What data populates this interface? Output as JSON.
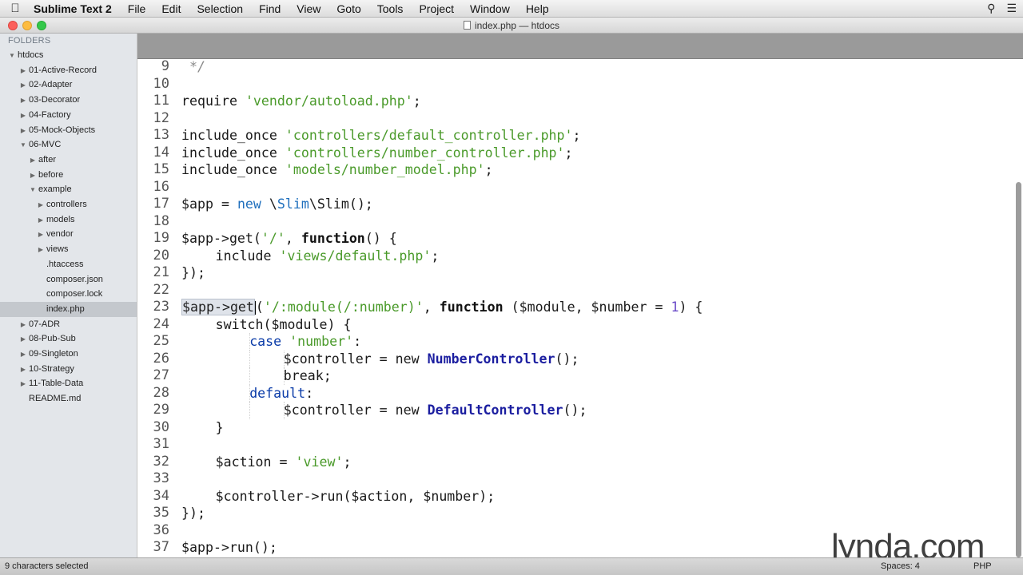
{
  "menubar": {
    "app_name": "Sublime Text 2",
    "items": [
      "File",
      "Edit",
      "Selection",
      "Find",
      "View",
      "Goto",
      "Tools",
      "Project",
      "Window",
      "Help"
    ],
    "right_icons": [
      "search-icon",
      "list-icon"
    ]
  },
  "window": {
    "title": "index.php — htdocs"
  },
  "sidebar": {
    "header": "FOLDERS",
    "items": [
      {
        "label": "htdocs",
        "depth": 0,
        "arrow": "▼"
      },
      {
        "label": "01-Active-Record",
        "depth": 1,
        "arrow": "▶"
      },
      {
        "label": "02-Adapter",
        "depth": 1,
        "arrow": "▶"
      },
      {
        "label": "03-Decorator",
        "depth": 1,
        "arrow": "▶"
      },
      {
        "label": "04-Factory",
        "depth": 1,
        "arrow": "▶"
      },
      {
        "label": "05-Mock-Objects",
        "depth": 1,
        "arrow": "▶"
      },
      {
        "label": "06-MVC",
        "depth": 1,
        "arrow": "▼"
      },
      {
        "label": "after",
        "depth": 2,
        "arrow": "▶"
      },
      {
        "label": "before",
        "depth": 2,
        "arrow": "▶"
      },
      {
        "label": "example",
        "depth": 2,
        "arrow": "▼"
      },
      {
        "label": "controllers",
        "depth": 3,
        "arrow": "▶"
      },
      {
        "label": "models",
        "depth": 3,
        "arrow": "▶"
      },
      {
        "label": "vendor",
        "depth": 3,
        "arrow": "▶"
      },
      {
        "label": "views",
        "depth": 3,
        "arrow": "▶"
      },
      {
        "label": ".htaccess",
        "depth": 3,
        "arrow": ""
      },
      {
        "label": "composer.json",
        "depth": 3,
        "arrow": ""
      },
      {
        "label": "composer.lock",
        "depth": 3,
        "arrow": ""
      },
      {
        "label": "index.php",
        "depth": 3,
        "arrow": "",
        "selected": true
      },
      {
        "label": "07-ADR",
        "depth": 1,
        "arrow": "▶"
      },
      {
        "label": "08-Pub-Sub",
        "depth": 1,
        "arrow": "▶"
      },
      {
        "label": "09-Singleton",
        "depth": 1,
        "arrow": "▶"
      },
      {
        "label": "10-Strategy",
        "depth": 1,
        "arrow": "▶"
      },
      {
        "label": "11-Table-Data",
        "depth": 1,
        "arrow": "▶"
      },
      {
        "label": "README.md",
        "depth": 1,
        "arrow": ""
      }
    ]
  },
  "editor": {
    "lines": [
      {
        "n": "9",
        "indent": 0,
        "tokens": [
          {
            "t": " */",
            "c": "cm"
          }
        ]
      },
      {
        "n": "10",
        "indent": 0,
        "tokens": []
      },
      {
        "n": "11",
        "indent": 0,
        "tokens": [
          {
            "t": "require ",
            "c": "op"
          },
          {
            "t": "'vendor/autoload.php'",
            "c": "str"
          },
          {
            "t": ";",
            "c": "op"
          }
        ]
      },
      {
        "n": "12",
        "indent": 0,
        "tokens": []
      },
      {
        "n": "13",
        "indent": 0,
        "tokens": [
          {
            "t": "include_once ",
            "c": "op"
          },
          {
            "t": "'controllers/default_controller.php'",
            "c": "str"
          },
          {
            "t": ";",
            "c": "op"
          }
        ]
      },
      {
        "n": "14",
        "indent": 0,
        "tokens": [
          {
            "t": "include_once ",
            "c": "op"
          },
          {
            "t": "'controllers/number_controller.php'",
            "c": "str"
          },
          {
            "t": ";",
            "c": "op"
          }
        ]
      },
      {
        "n": "15",
        "indent": 0,
        "tokens": [
          {
            "t": "include_once ",
            "c": "op"
          },
          {
            "t": "'models/number_model.php'",
            "c": "str"
          },
          {
            "t": ";",
            "c": "op"
          }
        ]
      },
      {
        "n": "16",
        "indent": 0,
        "tokens": []
      },
      {
        "n": "17",
        "indent": 0,
        "tokens": [
          {
            "t": "$app = ",
            "c": "op"
          },
          {
            "t": "new",
            "c": "new"
          },
          {
            "t": " \\",
            "c": "op"
          },
          {
            "t": "Slim",
            "c": "new"
          },
          {
            "t": "\\Slim();",
            "c": "op"
          }
        ]
      },
      {
        "n": "18",
        "indent": 0,
        "tokens": []
      },
      {
        "n": "19",
        "indent": 0,
        "tokens": [
          {
            "t": "$app->get(",
            "c": "op"
          },
          {
            "t": "'/'",
            "c": "str"
          },
          {
            "t": ", ",
            "c": "op"
          },
          {
            "t": "function",
            "c": "fn"
          },
          {
            "t": "() {",
            "c": "op"
          }
        ]
      },
      {
        "n": "20",
        "indent": 1,
        "tokens": [
          {
            "t": "include ",
            "c": "op"
          },
          {
            "t": "'views/default.php'",
            "c": "str"
          },
          {
            "t": ";",
            "c": "op"
          }
        ]
      },
      {
        "n": "21",
        "indent": 0,
        "tokens": [
          {
            "t": "});",
            "c": "op"
          }
        ]
      },
      {
        "n": "22",
        "indent": 0,
        "tokens": []
      },
      {
        "n": "23",
        "indent": 0,
        "tokens": [
          {
            "t": "$app->get",
            "c": "sel"
          },
          {
            "t": "(",
            "c": "op"
          },
          {
            "t": "'/:module(/:number)'",
            "c": "str"
          },
          {
            "t": ", ",
            "c": "op"
          },
          {
            "t": "function",
            "c": "fn"
          },
          {
            "t": " ($module, $number = ",
            "c": "op"
          },
          {
            "t": "1",
            "c": "num"
          },
          {
            "t": ") {",
            "c": "op"
          }
        ]
      },
      {
        "n": "24",
        "indent": 1,
        "tokens": [
          {
            "t": "switch($module) {",
            "c": "op"
          }
        ]
      },
      {
        "n": "25",
        "indent": 2,
        "tokens": [
          {
            "t": "case ",
            "c": "kw"
          },
          {
            "t": "'number'",
            "c": "str"
          },
          {
            "t": ":",
            "c": "op"
          }
        ]
      },
      {
        "n": "26",
        "indent": 3,
        "tokens": [
          {
            "t": "$controller = new ",
            "c": "op"
          },
          {
            "t": "NumberController",
            "c": "cls"
          },
          {
            "t": "();",
            "c": "op"
          }
        ]
      },
      {
        "n": "27",
        "indent": 3,
        "tokens": [
          {
            "t": "break;",
            "c": "op"
          }
        ]
      },
      {
        "n": "28",
        "indent": 2,
        "tokens": [
          {
            "t": "default",
            "c": "kw"
          },
          {
            "t": ":",
            "c": "op"
          }
        ]
      },
      {
        "n": "29",
        "indent": 3,
        "tokens": [
          {
            "t": "$controller = new ",
            "c": "op"
          },
          {
            "t": "DefaultController",
            "c": "cls"
          },
          {
            "t": "();",
            "c": "op"
          }
        ]
      },
      {
        "n": "30",
        "indent": 1,
        "tokens": [
          {
            "t": "}",
            "c": "op"
          }
        ]
      },
      {
        "n": "31",
        "indent": 0,
        "tokens": []
      },
      {
        "n": "32",
        "indent": 1,
        "tokens": [
          {
            "t": "$action = ",
            "c": "op"
          },
          {
            "t": "'view'",
            "c": "str"
          },
          {
            "t": ";",
            "c": "op"
          }
        ]
      },
      {
        "n": "33",
        "indent": 0,
        "tokens": []
      },
      {
        "n": "34",
        "indent": 1,
        "tokens": [
          {
            "t": "$controller->run($action, $number);",
            "c": "op"
          }
        ]
      },
      {
        "n": "35",
        "indent": 0,
        "tokens": [
          {
            "t": "});",
            "c": "op"
          }
        ]
      },
      {
        "n": "36",
        "indent": 0,
        "tokens": []
      },
      {
        "n": "37",
        "indent": 0,
        "tokens": [
          {
            "t": "$app->run();",
            "c": "op"
          }
        ]
      }
    ]
  },
  "watermark": "lynda.com",
  "statusbar": {
    "selection": "9 characters selected",
    "spaces": "Spaces: 4",
    "syntax": "PHP"
  }
}
